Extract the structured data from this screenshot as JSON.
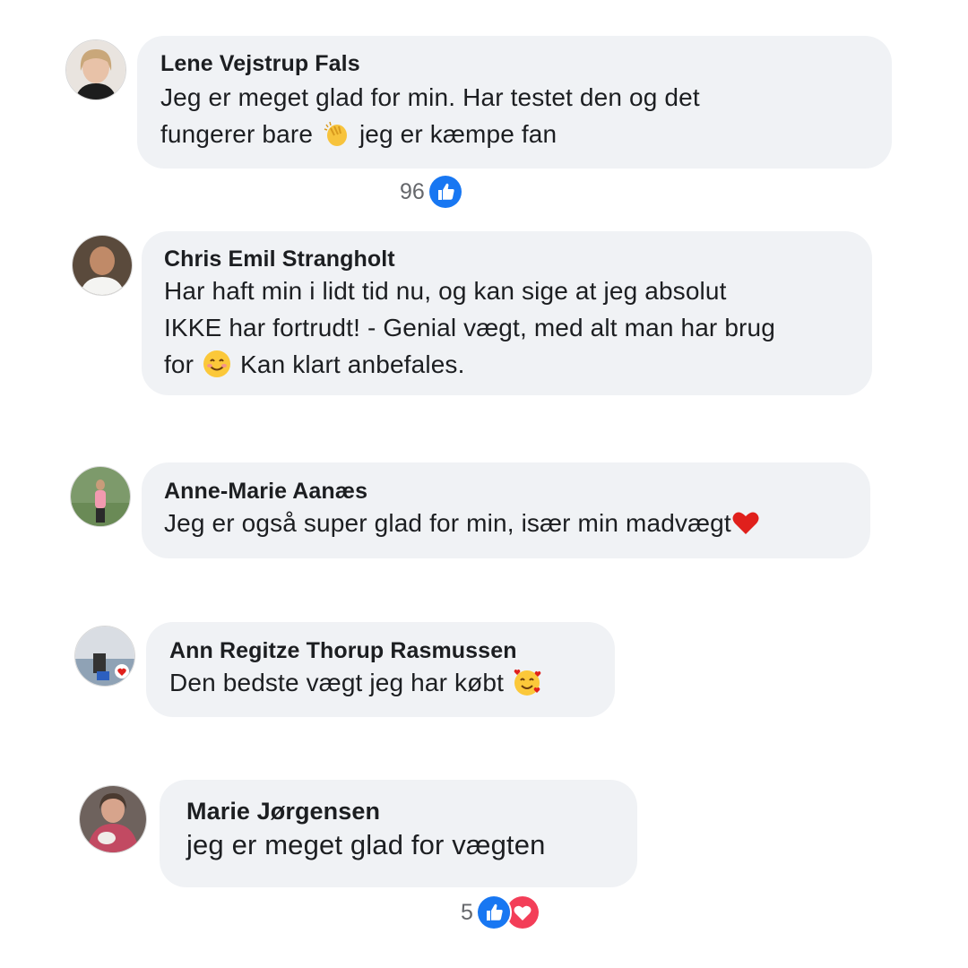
{
  "comments": [
    {
      "author": "Lene Vejstrup Fals",
      "text_lines": [
        "Jeg er meget glad for min. Har testet den og det",
        "fungerer bare",
        "jeg er kæmpe fan"
      ],
      "emoji": "clapping-hands-icon",
      "reaction_count": "96",
      "reactions": [
        "like-icon"
      ]
    },
    {
      "author": "Chris Emil Strangholt",
      "text_lines": [
        "Har haft min i lidt tid nu, og kan sige at jeg absolut",
        "IKKE har fortrudt! - Genial vægt, med alt man har brug",
        "for",
        "Kan klart anbefales."
      ],
      "emoji": "smiling-face-icon"
    },
    {
      "author": "Anne-Marie Aanæs",
      "text_lines": [
        "Jeg er også super glad for min, især min madvægt"
      ],
      "emoji": "red-heart-icon"
    },
    {
      "author": "Ann Regitze Thorup Rasmussen",
      "text_lines": [
        "Den bedste vægt jeg har købt"
      ],
      "emoji": "smiling-face-with-hearts-icon"
    },
    {
      "author": "Marie Jørgensen",
      "text_lines": [
        "jeg er meget glad for vægten"
      ],
      "reaction_count": "5",
      "reactions": [
        "like-icon",
        "love-icon"
      ]
    }
  ],
  "colors": {
    "bubble": "#f0f2f5",
    "like": "#1877f2",
    "love": "#f33e58",
    "count": "#65676b"
  }
}
